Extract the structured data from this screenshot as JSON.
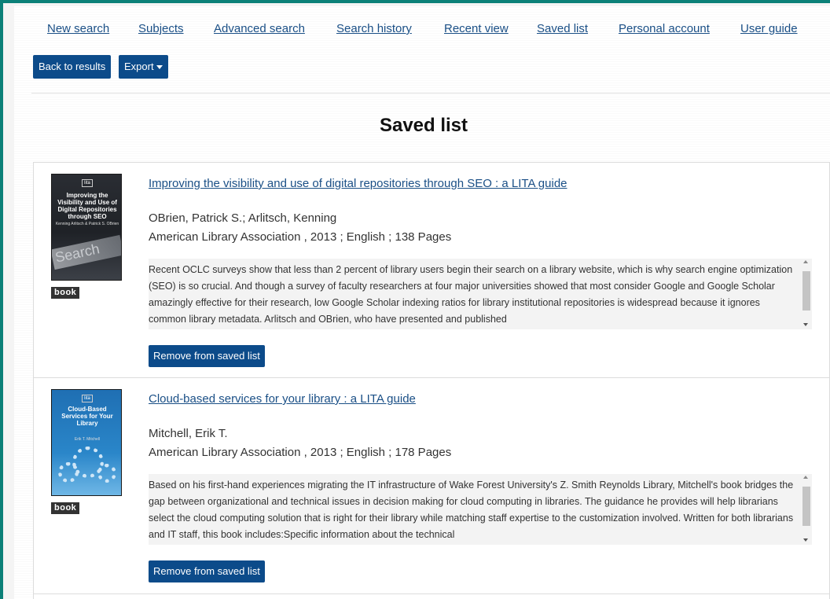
{
  "nav": {
    "items": [
      "New search",
      "Subjects",
      "Advanced search",
      "Search history",
      "Recent view",
      "Saved list",
      "Personal account",
      "User guide"
    ]
  },
  "toolbar": {
    "back_label": "Back to results",
    "export_label": "Export"
  },
  "page": {
    "title": "Saved list"
  },
  "records": [
    {
      "title": "Improving the visibility and use of digital repositories through SEO : a LITA guide",
      "authors": "OBrien, Patrick S.; Arlitsch, Kenning",
      "pub": "American Library Association , 2013 ; English ; 138 Pages",
      "type": "book",
      "abstract": "Recent OCLC surveys show that less than 2 percent of library users begin their search on a library website, which is why search engine optimization (SEO) is so crucial. And though a survey of faculty researchers at four major universities showed that most consider Google and Google Scholar amazingly effective for their research, low Google Scholar indexing ratios for library institutional repositories is widespread because it ignores common library metadata. Arlitsch and OBrien, who have presented and published",
      "remove_label": "Remove from saved list",
      "cover": {
        "badge": "lita",
        "title": "Improving the Visibility and Use of Digital Repositories through SEO",
        "author": "Kenning Arlitsch & Patrick S. OBrien",
        "word": "Search"
      }
    },
    {
      "title": "Cloud-based services for your library : a LITA guide",
      "authors": "Mitchell, Erik T.",
      "pub": "American Library Association , 2013 ; English ; 178 Pages",
      "type": "book",
      "abstract": "Based on his first-hand experiences migrating the IT infrastructure of Wake Forest University's Z. Smith Reynolds Library, Mitchell's book bridges the gap between organizational and technical issues in decision making for cloud computing in libraries. The guidance he provides will help librarians select the cloud computing solution that is right for their library while matching staff expertise to the customization involved. Written for both librarians and IT staff, this book includes:Specific information about the technical",
      "remove_label": "Remove from saved list",
      "cover": {
        "badge": "lita",
        "title": "Cloud-Based Services for Your Library",
        "author": "Erik T. Mitchell"
      }
    }
  ],
  "colors": {
    "frame": "#0b8078",
    "primary_button": "#0c4b8a",
    "link": "#1a4f86"
  }
}
